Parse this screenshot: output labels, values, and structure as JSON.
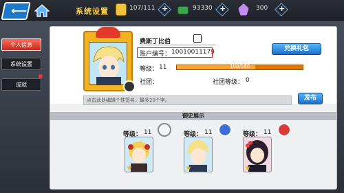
{
  "topbar": {
    "title": "系统设置",
    "resources": [
      {
        "icon": "coin-icon",
        "value": "107/111"
      },
      {
        "icon": "cash-icon",
        "value": "93330"
      },
      {
        "icon": "crystal-icon",
        "value": "300"
      }
    ]
  },
  "sidebar": {
    "items": [
      {
        "label": "个人信息",
        "active": true
      },
      {
        "label": "系统设置",
        "active": false
      },
      {
        "label": "成就",
        "active": false
      }
    ]
  },
  "profile": {
    "name": "费斯丁比伯",
    "account_label": "账户编号：",
    "account_id": "10010011179",
    "level_label": "等级：",
    "level_value": "11",
    "exp_text": "100/160",
    "exp_fraction": 0.625,
    "guild_label": "社团：",
    "guild_value": "",
    "guild_level_label": "社团等级：",
    "guild_level_value": "0",
    "redeem_button": "兑换礼包",
    "signature_placeholder": "点击此处编辑个性签名，最多20个字。",
    "publish_button": "发布"
  },
  "showcase": {
    "title": "御史展示",
    "cards": [
      {
        "level_label": "等级：",
        "level": "11"
      },
      {
        "level_label": "等级：",
        "level": "11"
      },
      {
        "level_label": "等级：",
        "level": "11"
      }
    ]
  },
  "colors": {
    "accent": "#1d78c9",
    "title": "#ffd24d",
    "exp_bar": "#e07800",
    "highlight_box": "#e02020"
  }
}
